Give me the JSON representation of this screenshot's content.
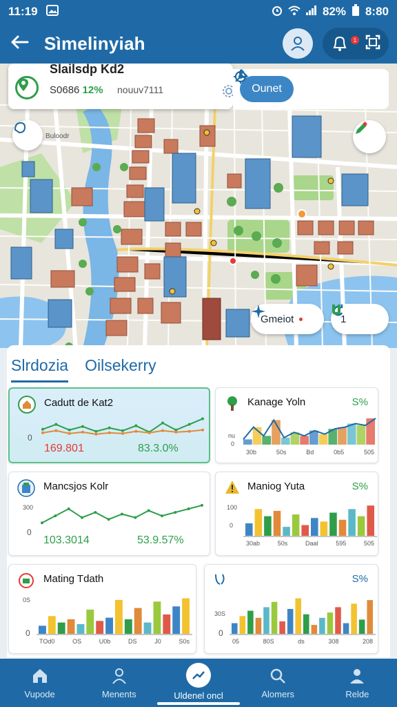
{
  "status": {
    "time": "11:19",
    "right": "8:80",
    "signal": "82%"
  },
  "appbar": {
    "title": "Sìmelinyiah",
    "notif_count": "1"
  },
  "search": {
    "heading": "Slailsdp Kd2",
    "value": "S0686",
    "value_pct": "12%",
    "hint": "nouuv7111"
  },
  "toolbar": {
    "ok_label": "Ounet"
  },
  "map": {
    "place_label": "Buloodr",
    "chip1_label": "Gmeiot",
    "chip2_label": "1"
  },
  "tabs": [
    {
      "label": "Slrdozia"
    },
    {
      "label": "Oilsekerry"
    }
  ],
  "cards": [
    {
      "title": "Cadutt de Kat2",
      "pct": "",
      "value_left": "169.801",
      "value_right": "83.3.0%",
      "y_tick": "0",
      "chart_data": {
        "type": "line",
        "series": [
          {
            "values": [
              15,
              22,
              14,
              19,
              12,
              17,
              13,
              20,
              11,
              24,
              14,
              22,
              30
            ]
          },
          {
            "values": [
              10,
              13,
              9,
              11,
              8,
              10,
              9,
              12,
              10,
              13,
              11,
              12,
              14
            ]
          }
        ]
      }
    },
    {
      "title": "Kanage Yoln",
      "pct": "S%",
      "x_ticks": [
        "30b",
        "50s",
        "Bd",
        "0b5",
        "505"
      ],
      "y_ticks": [
        "nu",
        "0"
      ],
      "chart_data": {
        "type": "area",
        "series": [
          {
            "values": [
              6,
              20,
              10,
              28,
              8,
              14,
              10,
              16,
              12,
              18,
              20,
              24,
              22,
              30
            ]
          }
        ]
      }
    },
    {
      "title": "Mancsjos Kolr",
      "pct": "",
      "value_left": "103.3014",
      "value_right": "53.9.57%",
      "y_ticks": [
        "300",
        "0"
      ],
      "chart_data": {
        "type": "line",
        "series": [
          {
            "values": [
              10,
              18,
              26,
              16,
              22,
              14,
              20,
              16,
              24,
              18,
              22,
              26,
              30
            ]
          }
        ]
      }
    },
    {
      "title": "Maniog Yuta",
      "pct": "S%",
      "x_ticks": [
        "30ab",
        "50s",
        "Daal",
        "595",
        "505"
      ],
      "y_ticks": [
        "100",
        "0"
      ],
      "chart_data": {
        "type": "bar",
        "values": [
          14,
          30,
          22,
          28,
          10,
          24,
          12,
          20,
          16,
          26,
          18,
          30,
          22,
          34
        ]
      }
    },
    {
      "title": "Mating Tdath",
      "pct": "",
      "x_ticks": [
        "TOd0",
        "OS",
        "U0b",
        "DS",
        "J0",
        "S0s"
      ],
      "y_ticks": [
        "0S",
        "0"
      ],
      "chart_data": {
        "type": "bar",
        "values": [
          10,
          22,
          14,
          18,
          12,
          30,
          16,
          20,
          42,
          18,
          32,
          14,
          40,
          24,
          34,
          44
        ]
      }
    },
    {
      "title": "",
      "pct": "S%",
      "x_ticks": [
        "05",
        "80S",
        "ds",
        "308",
        "208"
      ],
      "y_ticks": [
        "30S",
        "0"
      ],
      "chart_data": {
        "type": "bar",
        "values": [
          12,
          20,
          26,
          18,
          30,
          36,
          14,
          28,
          40,
          22,
          10,
          18,
          24,
          30,
          12,
          34,
          16,
          38
        ]
      }
    }
  ],
  "nav": [
    {
      "label": "Vupode"
    },
    {
      "label": "Menents"
    },
    {
      "label": "Uldenel oncl"
    },
    {
      "label": "Alomers"
    },
    {
      "label": "Relde"
    }
  ],
  "colors": {
    "primary": "#1f6aa6",
    "green": "#2e9e4a",
    "red": "#e53935",
    "accent_blue": "#3d86c6"
  }
}
